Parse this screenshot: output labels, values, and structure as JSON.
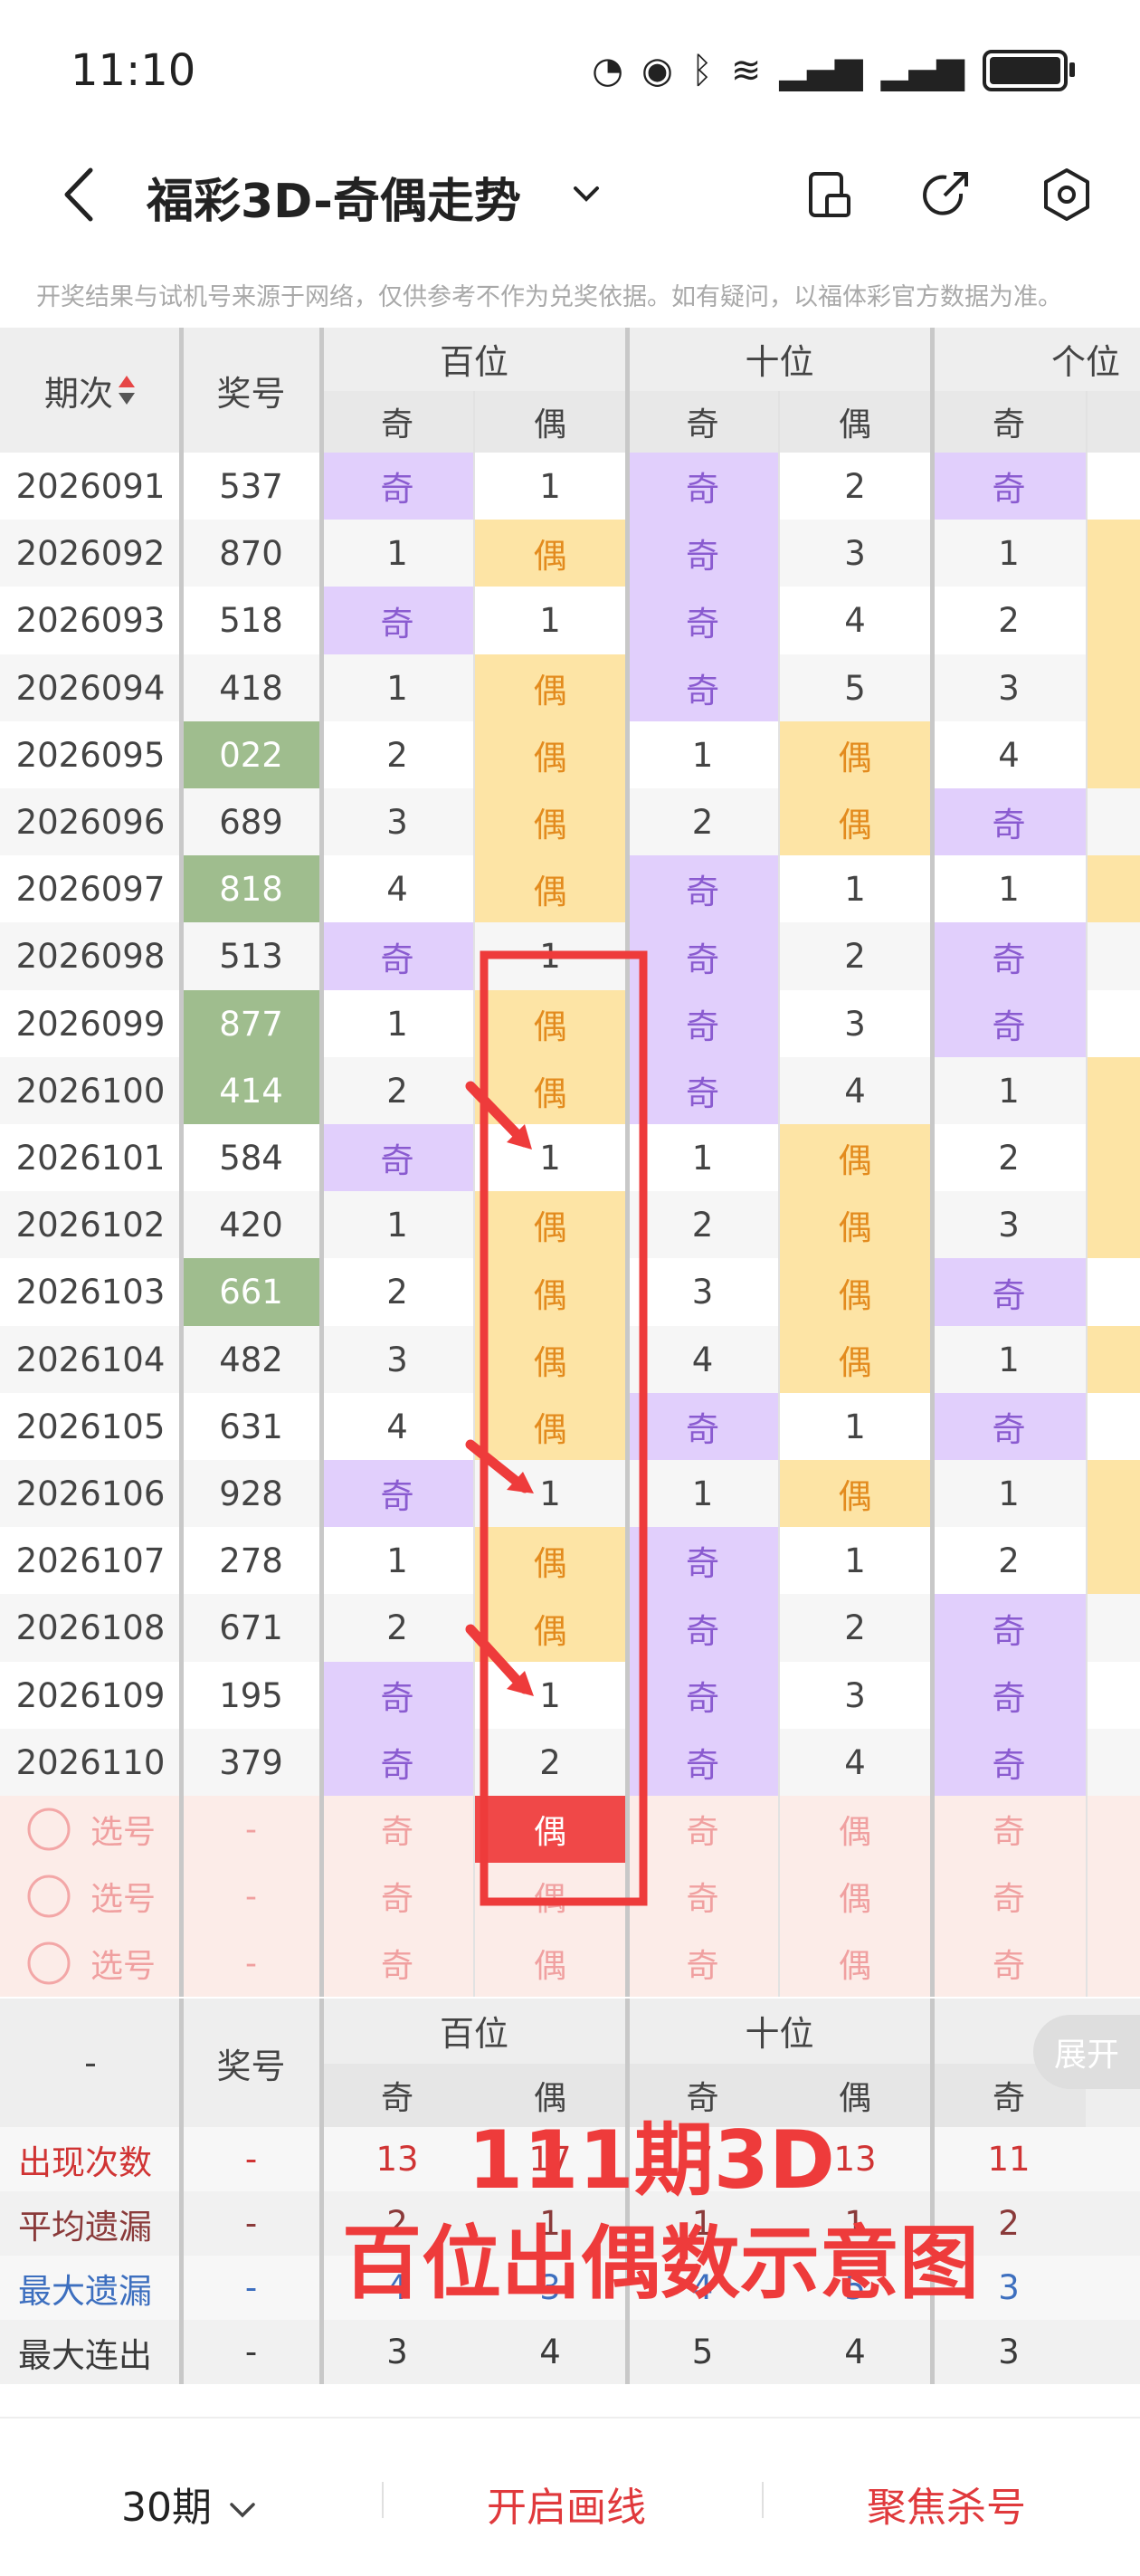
{
  "status": {
    "time": "11:10"
  },
  "header": {
    "title": "福彩3D-奇偶走势"
  },
  "disclaimer": "开奖结果与试机号来源于网络，仅供参考不作为兑奖依据。如有疑问，以福体彩官方数据为准。",
  "table": {
    "col_headers": {
      "period": "期次",
      "number": "奖号",
      "hundreds": "百位",
      "tens": "十位",
      "units": "个位",
      "odd": "奇",
      "even": "偶"
    },
    "rows": [
      {
        "period": "2026091",
        "number": "537",
        "cells": [
          "奇",
          "1",
          "奇",
          "2",
          "奇"
        ],
        "marks": [
          "o",
          "",
          "o",
          "",
          "o"
        ],
        "tail": "",
        "green": false
      },
      {
        "period": "2026092",
        "number": "870",
        "cells": [
          "1",
          "偶",
          "奇",
          "3",
          "1"
        ],
        "marks": [
          "",
          "e",
          "o",
          "",
          ""
        ],
        "tail": "e",
        "green": false
      },
      {
        "period": "2026093",
        "number": "518",
        "cells": [
          "奇",
          "1",
          "奇",
          "4",
          "2"
        ],
        "marks": [
          "o",
          "",
          "o",
          "",
          ""
        ],
        "tail": "e",
        "green": false
      },
      {
        "period": "2026094",
        "number": "418",
        "cells": [
          "1",
          "偶",
          "奇",
          "5",
          "3"
        ],
        "marks": [
          "",
          "e",
          "o",
          "",
          ""
        ],
        "tail": "e",
        "green": false
      },
      {
        "period": "2026095",
        "number": "022",
        "cells": [
          "2",
          "偶",
          "1",
          "偶",
          "4"
        ],
        "marks": [
          "",
          "e",
          "",
          "e",
          ""
        ],
        "tail": "e",
        "green": true
      },
      {
        "period": "2026096",
        "number": "689",
        "cells": [
          "3",
          "偶",
          "2",
          "偶",
          "奇"
        ],
        "marks": [
          "",
          "e",
          "",
          "e",
          "o"
        ],
        "tail": "",
        "green": false
      },
      {
        "period": "2026097",
        "number": "818",
        "cells": [
          "4",
          "偶",
          "奇",
          "1",
          "1"
        ],
        "marks": [
          "",
          "e",
          "o",
          "",
          ""
        ],
        "tail": "e",
        "green": true
      },
      {
        "period": "2026098",
        "number": "513",
        "cells": [
          "奇",
          "1",
          "奇",
          "2",
          "奇"
        ],
        "marks": [
          "o",
          "",
          "o",
          "",
          "o"
        ],
        "tail": "",
        "green": false
      },
      {
        "period": "2026099",
        "number": "877",
        "cells": [
          "1",
          "偶",
          "奇",
          "3",
          "奇"
        ],
        "marks": [
          "",
          "e",
          "o",
          "",
          "o"
        ],
        "tail": "",
        "green": true
      },
      {
        "period": "2026100",
        "number": "414",
        "cells": [
          "2",
          "偶",
          "奇",
          "4",
          "1"
        ],
        "marks": [
          "",
          "e",
          "o",
          "",
          ""
        ],
        "tail": "e",
        "green": true
      },
      {
        "period": "2026101",
        "number": "584",
        "cells": [
          "奇",
          "1",
          "1",
          "偶",
          "2"
        ],
        "marks": [
          "o",
          "",
          "",
          "e",
          ""
        ],
        "tail": "e",
        "green": false
      },
      {
        "period": "2026102",
        "number": "420",
        "cells": [
          "1",
          "偶",
          "2",
          "偶",
          "3"
        ],
        "marks": [
          "",
          "e",
          "",
          "e",
          ""
        ],
        "tail": "e",
        "green": false
      },
      {
        "period": "2026103",
        "number": "661",
        "cells": [
          "2",
          "偶",
          "3",
          "偶",
          "奇"
        ],
        "marks": [
          "",
          "e",
          "",
          "e",
          "o"
        ],
        "tail": "",
        "green": true
      },
      {
        "period": "2026104",
        "number": "482",
        "cells": [
          "3",
          "偶",
          "4",
          "偶",
          "1"
        ],
        "marks": [
          "",
          "e",
          "",
          "e",
          ""
        ],
        "tail": "e",
        "green": false
      },
      {
        "period": "2026105",
        "number": "631",
        "cells": [
          "4",
          "偶",
          "奇",
          "1",
          "奇"
        ],
        "marks": [
          "",
          "e",
          "o",
          "",
          "o"
        ],
        "tail": "",
        "green": false
      },
      {
        "period": "2026106",
        "number": "928",
        "cells": [
          "奇",
          "1",
          "1",
          "偶",
          "1"
        ],
        "marks": [
          "o",
          "",
          "",
          "e",
          ""
        ],
        "tail": "e",
        "green": false
      },
      {
        "period": "2026107",
        "number": "278",
        "cells": [
          "1",
          "偶",
          "奇",
          "1",
          "2"
        ],
        "marks": [
          "",
          "e",
          "o",
          "",
          ""
        ],
        "tail": "e",
        "green": false
      },
      {
        "period": "2026108",
        "number": "671",
        "cells": [
          "2",
          "偶",
          "奇",
          "2",
          "奇"
        ],
        "marks": [
          "",
          "e",
          "o",
          "",
          "o"
        ],
        "tail": "",
        "green": false
      },
      {
        "period": "2026109",
        "number": "195",
        "cells": [
          "奇",
          "1",
          "奇",
          "3",
          "奇"
        ],
        "marks": [
          "o",
          "",
          "o",
          "",
          "o"
        ],
        "tail": "",
        "green": false
      },
      {
        "period": "2026110",
        "number": "379",
        "cells": [
          "奇",
          "2",
          "奇",
          "4",
          "奇"
        ],
        "marks": [
          "o",
          "",
          "o",
          "",
          "o"
        ],
        "tail": "",
        "green": false
      }
    ],
    "pick_rows": [
      {
        "label": "选号",
        "dash": "-",
        "cells": [
          "奇",
          "偶",
          "奇",
          "偶",
          "奇"
        ],
        "selected": 1
      },
      {
        "label": "选号",
        "dash": "-",
        "cells": [
          "奇",
          "偶",
          "奇",
          "偶",
          "奇"
        ],
        "selected": -1
      },
      {
        "label": "选号",
        "dash": "-",
        "cells": [
          "奇",
          "偶",
          "奇",
          "偶",
          "奇"
        ],
        "selected": -1
      }
    ]
  },
  "stats": {
    "header": {
      "dash": "-",
      "number": "奖号",
      "hundreds": "百位",
      "tens": "十位",
      "units": "个位",
      "odd": "奇",
      "even": "偶"
    },
    "rows": [
      {
        "label": "出现次数",
        "dash": "-",
        "values": [
          "13",
          "17",
          "7",
          "13",
          "11"
        ],
        "color": "#d03434"
      },
      {
        "label": "平均遗漏",
        "dash": "-",
        "values": [
          "2",
          "1",
          "1",
          "1",
          "2"
        ],
        "color": "#8a3a3a"
      },
      {
        "label": "最大遗漏",
        "dash": "-",
        "values": [
          "4",
          "3",
          "4",
          "5",
          "3"
        ],
        "color": "#3d6fbf"
      },
      {
        "label": "最大连出",
        "dash": "-",
        "values": [
          "3",
          "4",
          "5",
          "4",
          "3"
        ],
        "color": "#3a3a3a"
      }
    ],
    "expand_label": "展开"
  },
  "overlay": {
    "line1": "111期3D",
    "line2": "百位出偶数示意图"
  },
  "bottom": {
    "periods": "30期",
    "draw_line": "开启画线",
    "focus_kill": "聚焦杀号"
  },
  "colors": {
    "odd": "#e1cffc",
    "even": "#fde4a5",
    "green": "#9fbd8e",
    "red": "#ee3b3b"
  },
  "icons": [
    "back-arrow-icon",
    "chevron-down-icon",
    "phone-rotate-icon",
    "share-icon",
    "settings-icon",
    "sort-arrows-icon"
  ]
}
